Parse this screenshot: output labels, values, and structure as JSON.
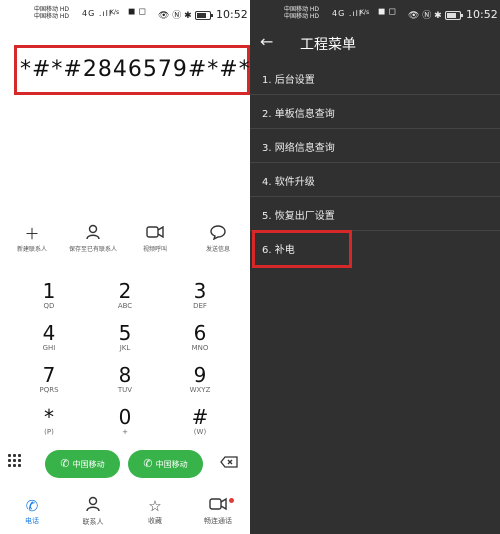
{
  "left": {
    "status": {
      "carrier_line1": "中国移动 HD",
      "carrier_line2": "中国移动 HD",
      "signal": "4G .ıll",
      "speed": "K/s",
      "time": "10:52"
    },
    "dialed_code": "*#*#2846579#*#*",
    "actions": [
      {
        "icon": "plus-icon",
        "glyph": "+",
        "label": "新建联系人"
      },
      {
        "icon": "person-icon",
        "glyph": "◯",
        "label": "保存至已有联系人"
      },
      {
        "icon": "video-call-icon",
        "glyph": "▭",
        "label": "视频呼叫"
      },
      {
        "icon": "message-icon",
        "glyph": "◌",
        "label": "发送信息"
      }
    ],
    "keys": [
      {
        "num": "1",
        "sub": "QD"
      },
      {
        "num": "2",
        "sub": "ABC"
      },
      {
        "num": "3",
        "sub": "DEF"
      },
      {
        "num": "4",
        "sub": "GHI"
      },
      {
        "num": "5",
        "sub": "JKL"
      },
      {
        "num": "6",
        "sub": "MNO"
      },
      {
        "num": "7",
        "sub": "PQRS"
      },
      {
        "num": "8",
        "sub": "TUV"
      },
      {
        "num": "9",
        "sub": "WXYZ"
      },
      {
        "num": "*",
        "sub": "(P)"
      },
      {
        "num": "0",
        "sub": "+"
      },
      {
        "num": "#",
        "sub": "(W)"
      }
    ],
    "call_buttons": [
      {
        "label": "中国移动"
      },
      {
        "label": "中国移动"
      }
    ],
    "tabs": [
      {
        "label": "电话",
        "icon": "phone-icon",
        "glyph": "✆"
      },
      {
        "label": "联系人",
        "icon": "contacts-icon",
        "glyph": "◉"
      },
      {
        "label": "收藏",
        "icon": "star-icon",
        "glyph": "☆"
      },
      {
        "label": "畅连通话",
        "icon": "video-chat-icon",
        "glyph": "▣"
      }
    ],
    "accent_color": "#37b34a"
  },
  "right": {
    "status": {
      "carrier_line1": "中国移动 HD",
      "carrier_line2": "中国移动 HD",
      "signal": "4G .ıll",
      "speed": "K/s",
      "time": "10:52"
    },
    "title": "工程菜单",
    "menu": [
      "1. 后台设置",
      "2. 单板信息查询",
      "3. 网络信息查询",
      "4. 软件升级",
      "5. 恢复出厂设置",
      "6. 补电"
    ],
    "highlight_color": "#d62828"
  }
}
